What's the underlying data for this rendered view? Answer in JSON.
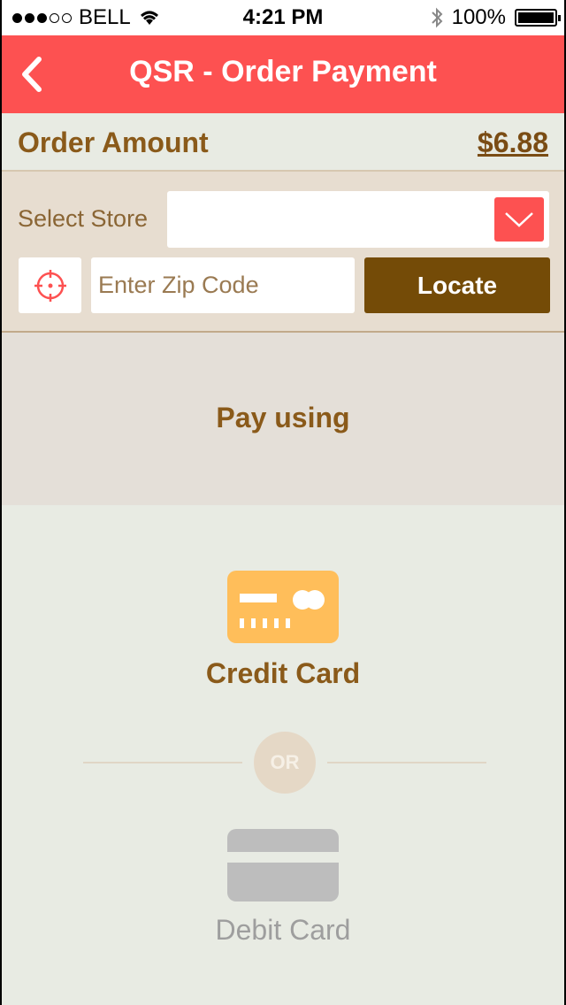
{
  "status_bar": {
    "carrier": "BELL",
    "time": "4:21 PM",
    "battery": "100%"
  },
  "nav": {
    "title": "QSR - Order Payment"
  },
  "order": {
    "label": "Order Amount",
    "amount": "$6.88"
  },
  "store": {
    "label": "Select Store",
    "selected_value": "",
    "zip_placeholder": "Enter Zip Code",
    "locate_label": "Locate"
  },
  "payment": {
    "header": "Pay using",
    "credit_label": "Credit Card",
    "or_label": "OR",
    "debit_label": "Debit Card"
  },
  "colors": {
    "accent_red": "#fd5151",
    "brown_button": "#744b07",
    "credit_card_yellow": "#ffbe5a",
    "debit_card_gray": "#bdbdbd"
  },
  "icons": [
    "back-chevron-icon",
    "wifi-icon",
    "bluetooth-icon",
    "battery-icon",
    "dropdown-chevron-icon",
    "crosshair-locate-icon",
    "credit-card-icon",
    "debit-card-icon"
  ]
}
